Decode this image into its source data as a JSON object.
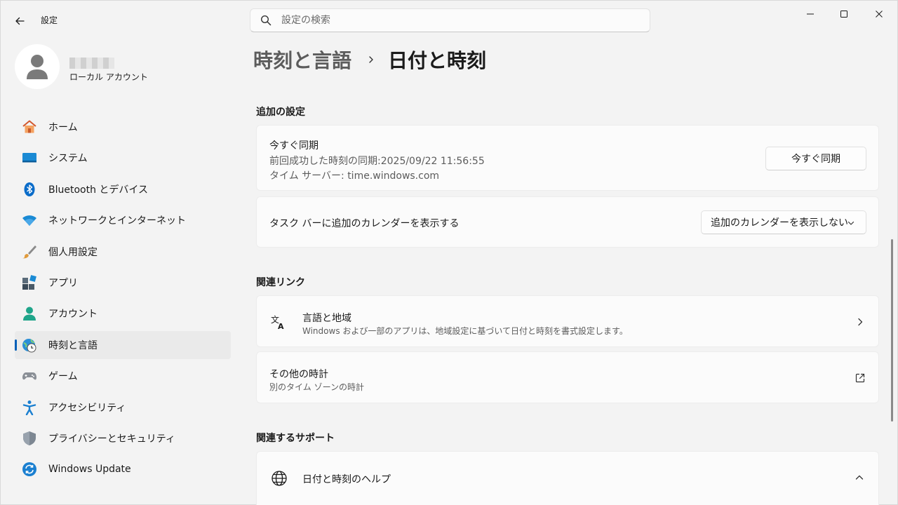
{
  "app": {
    "title": "設定"
  },
  "search": {
    "placeholder": "設定の検索"
  },
  "profile": {
    "account_type": "ローカル アカウント"
  },
  "nav": {
    "items": [
      {
        "label": "ホーム",
        "icon": "home-icon"
      },
      {
        "label": "システム",
        "icon": "system-icon"
      },
      {
        "label": "Bluetooth とデバイス",
        "icon": "bluetooth-icon"
      },
      {
        "label": "ネットワークとインターネット",
        "icon": "wifi-icon"
      },
      {
        "label": "個人用設定",
        "icon": "brush-icon"
      },
      {
        "label": "アプリ",
        "icon": "apps-icon"
      },
      {
        "label": "アカウント",
        "icon": "account-icon"
      },
      {
        "label": "時刻と言語",
        "icon": "time-language-icon",
        "active": true
      },
      {
        "label": "ゲーム",
        "icon": "gamepad-icon"
      },
      {
        "label": "アクセシビリティ",
        "icon": "accessibility-icon"
      },
      {
        "label": "プライバシーとセキュリティ",
        "icon": "shield-icon"
      },
      {
        "label": "Windows Update",
        "icon": "windows-update-icon"
      }
    ]
  },
  "breadcrumb": {
    "parent": "時刻と言語",
    "current": "日付と時刻"
  },
  "additional": {
    "title": "追加の設定",
    "sync": {
      "title": "今すぐ同期",
      "last_sync": "前回成功した時刻の同期:2025/09/22 11:56:55",
      "server": "タイム サーバー: time.windows.com",
      "button": "今すぐ同期"
    },
    "calendar": {
      "label": "タスク バーに追加のカレンダーを表示する",
      "selected": "追加のカレンダーを表示しない"
    }
  },
  "related": {
    "title": "関連リンク",
    "language_region": {
      "title": "言語と地域",
      "desc": "Windows および一部のアプリは、地域設定に基づいて日付と時刻を書式設定します。"
    },
    "other_clocks": {
      "title": "その他の時計",
      "desc": "別のタイム ゾーンの時計"
    }
  },
  "support": {
    "title": "関連するサポート",
    "help": {
      "title": "日付と時刻のヘルプ"
    }
  },
  "colors": {
    "accent": "#005fb8",
    "background": "#f3f3f3",
    "card": "#fbfbfb"
  }
}
